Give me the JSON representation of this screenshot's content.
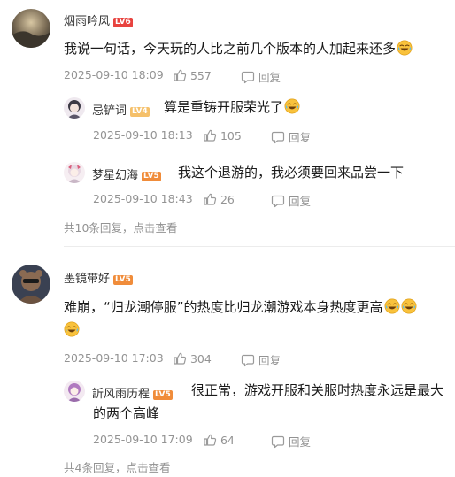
{
  "comments": [
    {
      "user": "烟雨吟风",
      "level": "LV6",
      "text": "我说一句话，今天玩的人比之前几个版本的人加起来还多",
      "time": "2025-09-10 18:09",
      "likes": "557",
      "reply_label": "回复",
      "replies": [
        {
          "user": "忌铲词",
          "level": "LV4",
          "text": "算是重铸开服荣光了",
          "time": "2025-09-10 18:13",
          "likes": "105",
          "reply_label": "回复"
        },
        {
          "user": "梦星幻海",
          "level": "LV5",
          "text": "我这个退游的，我必须要回来品尝一下",
          "time": "2025-09-10 18:43",
          "likes": "26",
          "reply_label": "回复"
        }
      ],
      "more_replies": "共10条回复，点击查看"
    },
    {
      "user": "墨镜带好",
      "level": "LV5",
      "text_line1": "难崩，“归龙潮停服”的热度比归龙潮游戏本身热度更高",
      "time": "2025-09-10 17:03",
      "likes": "304",
      "reply_label": "回复",
      "replies": [
        {
          "user": "訢风雨历程",
          "level": "LV5",
          "text_line1": "很正常，游戏开服和关服时热度永远是最大",
          "text_line2": "的两个高峰",
          "time": "2025-09-10 17:09",
          "likes": "64",
          "reply_label": "回复"
        }
      ],
      "more_replies": "共4条回复，点击查看"
    }
  ],
  "icons": {
    "like": "thumb-up-icon",
    "reply": "comment-bubble-icon",
    "emoji": "laughing-tears-emoji"
  },
  "colors": {
    "level6": "#e8433f",
    "level5": "#f08c3a",
    "level4": "#f5c06a",
    "meta": "#939393"
  }
}
